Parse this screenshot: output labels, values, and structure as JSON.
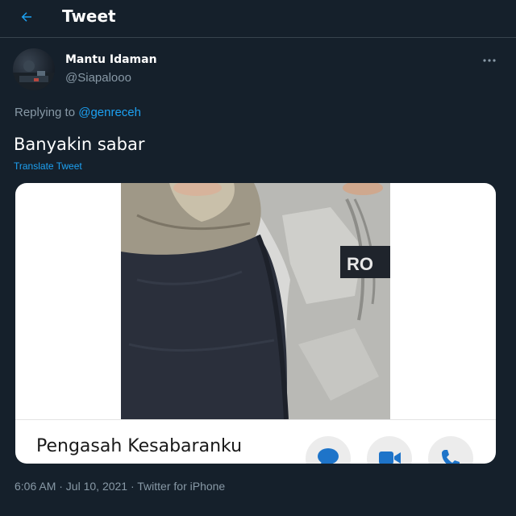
{
  "header": {
    "title": "Tweet",
    "back_icon": "arrow-left-icon",
    "accent": "#1da1f2"
  },
  "author": {
    "name": "Mantu Idaman",
    "handle": "@Siapalooo"
  },
  "reply": {
    "prefix": "Replying to",
    "mention": "@genreceh"
  },
  "tweet": {
    "text": "Banyakin sabar",
    "translate_label": "Translate Tweet"
  },
  "media": {
    "caption": "Pengasah Kesabaranku",
    "photo_text": "RO",
    "icons": [
      "chat-bubble-icon",
      "video-camera-icon",
      "phone-icon"
    ]
  },
  "meta": {
    "timestamp": "6:06 AM · Jul 10, 2021 · Twitter for iPhone"
  },
  "colors": {
    "background": "#15202b",
    "secondary_text": "#8899a6",
    "link": "#1da1f2",
    "border": "#38444d"
  }
}
